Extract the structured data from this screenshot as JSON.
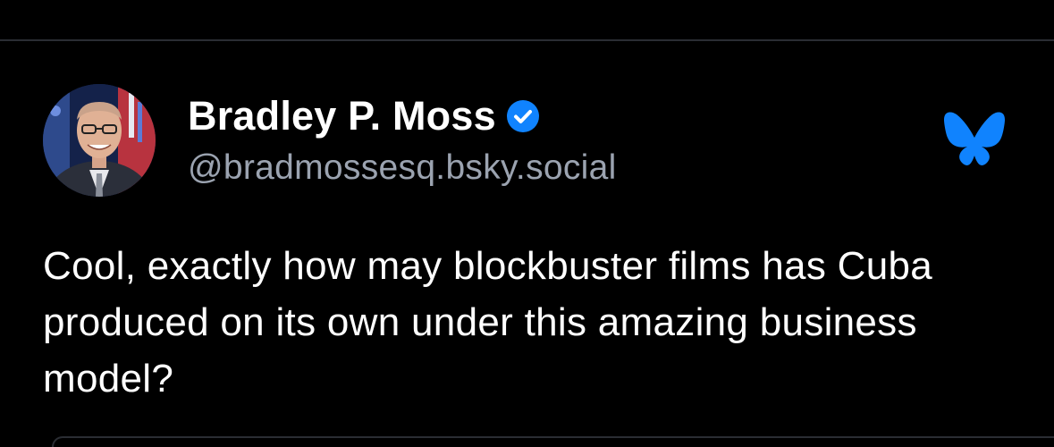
{
  "post": {
    "author": {
      "display_name": "Bradley P. Moss",
      "handle": "@bradmossesq.bsky.social",
      "verified": true,
      "avatar_icon": "user-avatar"
    },
    "text": "Cool, exactly how may blockbuster films has Cuba produced on its own under this amazing business model?",
    "platform_logo": "bluesky-butterfly-icon"
  },
  "colors": {
    "background": "#000000",
    "text": "#ffffff",
    "handle": "#9ba3b0",
    "accent_blue": "#1083fe",
    "divider": "#2a2d33"
  }
}
